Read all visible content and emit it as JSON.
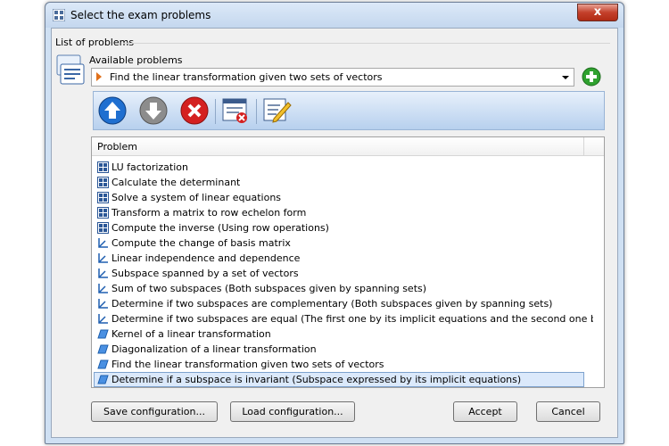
{
  "window": {
    "title": "Select the exam problems",
    "close_label": "x"
  },
  "group": {
    "label": "List of problems"
  },
  "available": {
    "label": "Available problems",
    "selected": "Find the linear transformation given two sets of vectors"
  },
  "toolbar": {
    "buttons": [
      "move-up",
      "move-down",
      "delete",
      "clear-list",
      "edit"
    ]
  },
  "table": {
    "column": "Problem",
    "rows": [
      {
        "icon": "matrix-icon",
        "label": "LU factorization"
      },
      {
        "icon": "matrix-icon",
        "label": "Calculate the determinant"
      },
      {
        "icon": "matrix-icon",
        "label": "Solve a system of linear equations"
      },
      {
        "icon": "matrix-icon",
        "label": "Transform a matrix to row echelon form"
      },
      {
        "icon": "matrix-icon",
        "label": "Compute the inverse (Using row operations)"
      },
      {
        "icon": "axes-icon",
        "label": "Compute the change of basis matrix"
      },
      {
        "icon": "axes-icon",
        "label": "Linear independence and dependence"
      },
      {
        "icon": "axes-icon",
        "label": "Subspace spanned by a set of vectors"
      },
      {
        "icon": "axes-icon",
        "label": "Sum of two subspaces (Both subspaces given by spanning sets)"
      },
      {
        "icon": "axes-icon",
        "label": "Determine if two subspaces are complementary (Both subspaces given by spanning sets)"
      },
      {
        "icon": "axes-icon",
        "label": "Determine if two subspaces are equal (The first one by its implicit equations and the second one by a span..."
      },
      {
        "icon": "plane-icon",
        "label": "Kernel of a linear transformation"
      },
      {
        "icon": "plane-icon",
        "label": "Diagonalization of a linear transformation"
      },
      {
        "icon": "plane-icon",
        "label": "Find the linear transformation given two sets of vectors"
      },
      {
        "icon": "plane-icon",
        "label": "Determine if a subspace is invariant (Subspace expressed by its implicit equations)",
        "selected": true
      }
    ]
  },
  "buttons": {
    "save": "Save configuration...",
    "load": "Load configuration...",
    "accept": "Accept",
    "cancel": "Cancel"
  },
  "colors": {
    "title_bg": "#c4d7ee",
    "close": "#c4402b",
    "selection": "#dbe9fb",
    "toolbar": "#b7d0ee"
  }
}
